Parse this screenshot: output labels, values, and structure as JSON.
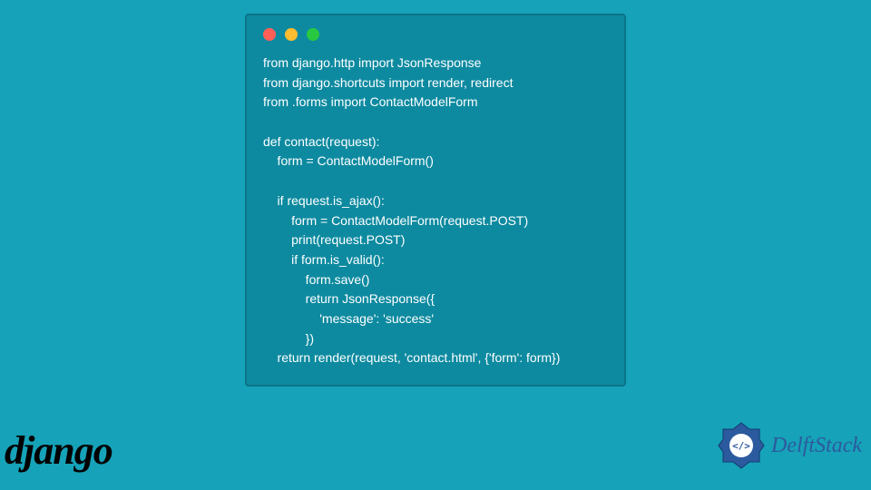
{
  "code": {
    "lines": [
      "from django.http import JsonResponse",
      "from django.shortcuts import render, redirect",
      "from .forms import ContactModelForm",
      "",
      "def contact(request):",
      "    form = ContactModelForm()",
      "",
      "    if request.is_ajax():",
      "        form = ContactModelForm(request.POST)",
      "        print(request.POST)",
      "        if form.is_valid():",
      "            form.save()",
      "            return JsonResponse({",
      "                'message': 'success'",
      "            })",
      "    return render(request, 'contact.html', {'form': form})"
    ]
  },
  "logos": {
    "django": "django",
    "delftstack": "DelftStack"
  },
  "colors": {
    "page_bg": "#16a2b8",
    "card_bg": "#0d8aa0",
    "code_text": "#ffffff",
    "django_text": "#000000",
    "delftstack_text": "#2c5a9e"
  }
}
